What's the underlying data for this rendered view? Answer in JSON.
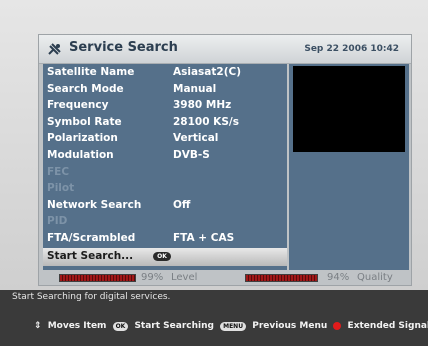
{
  "header": {
    "title": "Service Search",
    "datetime": "Sep 22 2006 10:42"
  },
  "rows": [
    {
      "label": "Satellite Name",
      "value": "Asiasat2(C)",
      "enabled": true
    },
    {
      "label": "Search Mode",
      "value": "Manual",
      "enabled": true
    },
    {
      "label": "Frequency",
      "value": "3980 MHz",
      "enabled": true
    },
    {
      "label": "Symbol Rate",
      "value": "28100 KS/s",
      "enabled": true
    },
    {
      "label": "Polarization",
      "value": "Vertical",
      "enabled": true
    },
    {
      "label": "Modulation",
      "value": "DVB-S",
      "enabled": true
    },
    {
      "label": "FEC",
      "value": "",
      "enabled": false
    },
    {
      "label": "Pilot",
      "value": "",
      "enabled": false
    },
    {
      "label": "Network Search",
      "value": "Off",
      "enabled": true
    },
    {
      "label": "PID",
      "value": "",
      "enabled": false
    },
    {
      "label": "FTA/Scrambled",
      "value": "FTA + CAS",
      "enabled": true
    }
  ],
  "start_search": {
    "label": "Start Search...",
    "key": "OK"
  },
  "signal": {
    "level_pct": 0.99,
    "level_text": "99%",
    "level_label": "Level",
    "quality_pct": 0.94,
    "quality_text": "94%",
    "quality_label": "Quality"
  },
  "footer": {
    "status": "Start Searching for digital services.",
    "help": {
      "move_label": "Moves Item",
      "ok_key": "OK",
      "ok_label": "Start Searching",
      "menu_key": "MENU",
      "menu_label": "Previous Menu",
      "red_label": "Extended Signal"
    }
  },
  "colors": {
    "list_bg": "#55708a",
    "bar_fill": "#a01818",
    "red_button": "#e01b1b"
  }
}
